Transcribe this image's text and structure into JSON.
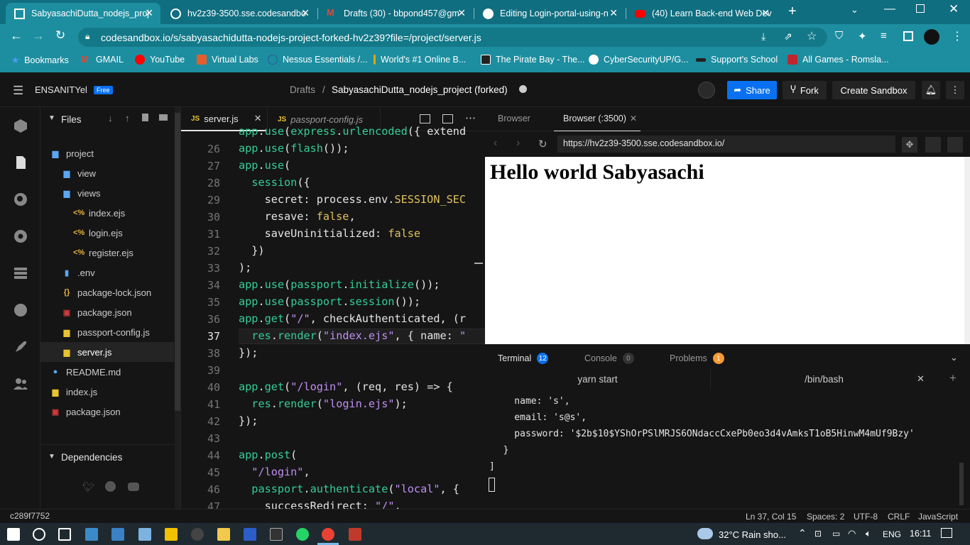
{
  "browser": {
    "tabs": [
      {
        "title": "SabyasachiDutta_nodejs_proj",
        "active": true
      },
      {
        "title": "hv2z39-3500.sse.codesandbo",
        "active": false
      },
      {
        "title": "Drafts (30) - bbpond457@gm",
        "active": false
      },
      {
        "title": "Editing Login-portal-using-n",
        "active": false
      },
      {
        "title": "(40) Learn Back-end Web Dev",
        "active": false
      }
    ],
    "url": "codesandbox.io/s/sabyasachidutta-nodejs-project-forked-hv2z39?file=/project/server.js",
    "bookmarks": [
      "Bookmarks",
      "GMAIL",
      "YouTube",
      "Virtual Labs",
      "Nessus Essentials /...",
      "World's #1 Online B...",
      "The Pirate Bay - The...",
      "CyberSecurityUP/G...",
      "Support's School",
      "All Games - Romsla..."
    ]
  },
  "header": {
    "workspace": "ENSANITYel",
    "plan": "Free",
    "breadcrumb_root": "Drafts",
    "breadcrumb_sep": "/",
    "project": "SabyasachiDutta_nodejs_project (forked)",
    "share": "Share",
    "fork": "Fork",
    "create": "Create Sandbox"
  },
  "explorer": {
    "title": "Files",
    "items": [
      {
        "name": "project",
        "type": "folder"
      },
      {
        "name": "view",
        "type": "folder"
      },
      {
        "name": "views",
        "type": "folder-open"
      },
      {
        "name": "index.ejs",
        "type": "ejs"
      },
      {
        "name": "login.ejs",
        "type": "ejs"
      },
      {
        "name": "register.ejs",
        "type": "ejs"
      },
      {
        "name": ".env",
        "type": "file"
      },
      {
        "name": "package-lock.json",
        "type": "json"
      },
      {
        "name": "package.json",
        "type": "npm"
      },
      {
        "name": "passport-config.js",
        "type": "js"
      },
      {
        "name": "server.js",
        "type": "js"
      },
      {
        "name": "README.md",
        "type": "info"
      },
      {
        "name": "index.js",
        "type": "js"
      },
      {
        "name": "package.json",
        "type": "npm"
      }
    ],
    "dependencies": "Dependencies"
  },
  "editor": {
    "tabs": [
      "server.js",
      "passport-config.js"
    ],
    "line_numbers": [
      "26",
      "27",
      "28",
      "29",
      "30",
      "31",
      "32",
      "33",
      "34",
      "35",
      "36",
      "37",
      "38",
      "39",
      "40",
      "41",
      "42",
      "43",
      "44",
      "45",
      "46",
      "47"
    ],
    "current_line": "37"
  },
  "preview": {
    "tabs": [
      "Browser",
      "Browser (:3500)"
    ],
    "url": "https://hv2z39-3500.sse.codesandbox.io/",
    "heading": "Hello world Sabyasachi"
  },
  "terminal": {
    "tabs": [
      {
        "label": "Terminal",
        "badge": "12"
      },
      {
        "label": "Console",
        "badge": "0"
      },
      {
        "label": "Problems",
        "badge": "1"
      }
    ],
    "sessions": [
      "yarn start",
      "/bin/bash"
    ],
    "lines": [
      "    name: 's',",
      "    email: 's@s',",
      "    password: '$2b$10$YShOrPSlMRJS6ONdaccCxePb0eo3d4vAmksT1oB5HinwM4mUf9Bzy'",
      "  }",
      "]"
    ]
  },
  "status": {
    "commit": "c289f7752",
    "position": "Ln 37, Col 15",
    "spaces": "Spaces: 2",
    "encoding": "UTF-8",
    "eol": "CRLF",
    "language": "JavaScript"
  },
  "taskbar": {
    "weather": "32°C  Rain sho...",
    "lang": "ENG",
    "time": "16:11"
  },
  "colors": {
    "chrome_teal": "#1d8ea0",
    "share_blue": "#0971f1",
    "keyword_green": "#35cd96",
    "string_purple": "#bf8ef2",
    "const_yellow": "#e0c061"
  }
}
